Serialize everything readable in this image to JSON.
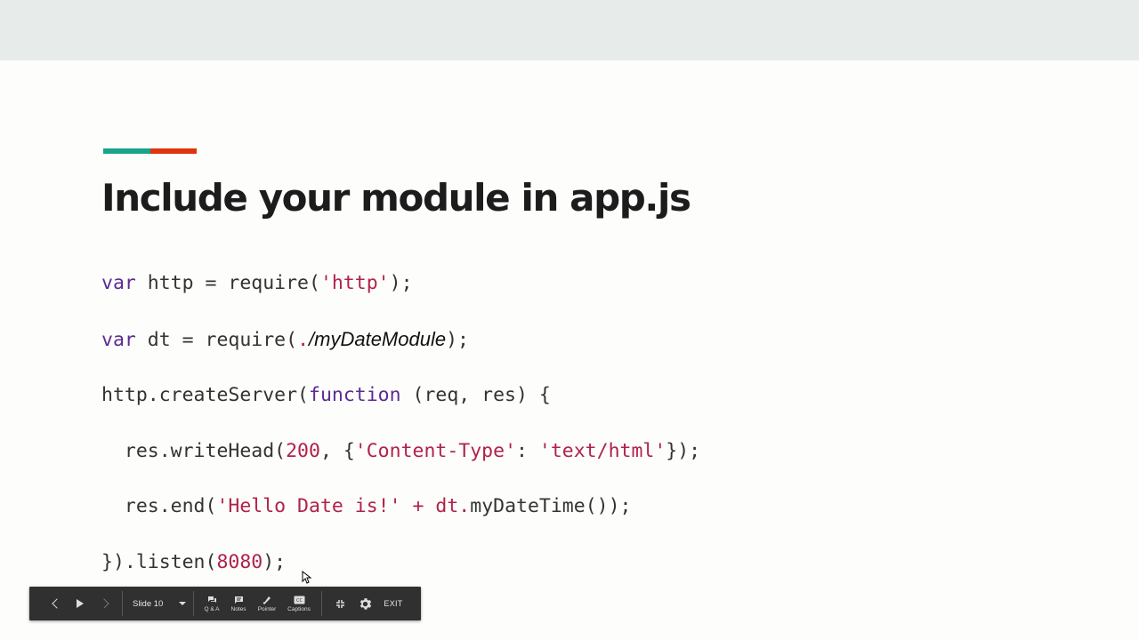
{
  "slide": {
    "title": "Include your module in app.js",
    "colors": {
      "accent_green": "#1aa389",
      "accent_red": "#e0340e",
      "keyword": "#5b2b94",
      "string": "#b0224a"
    },
    "code": {
      "l1_kw": "var",
      "l1_a": " http = require(",
      "l1_str": "'http'",
      "l1_b": ");",
      "l2_kw": "var",
      "l2_a": " dt = require(",
      "l2_dot": ".",
      "l2_it": "/myDateModule",
      "l2_b": ");",
      "l3_a": "http.createServer(",
      "l3_kw": "function",
      "l3_b": " (req, res) {",
      "l4_a": "  res.writeHead(",
      "l4_num": "200",
      "l4_b": ", {",
      "l4_str1": "'Content-Type'",
      "l4_c": ": ",
      "l4_str2": "'text/html'",
      "l4_d": "});",
      "l5_a": "  res.end(",
      "l5_str": "'Hello Date is!'",
      "l5_plus": " + ",
      "l5_dt": "dt.",
      "l5_b": "myDateTime());",
      "l6_a": "}).listen(",
      "l6_num": "8080",
      "l6_b": ");"
    }
  },
  "toolbar": {
    "slide_label": "Slide 10",
    "qa_label": "Q & A",
    "notes_label": "Notes",
    "pointer_label": "Pointer",
    "captions_label": "Captions",
    "exit_label": "EXIT",
    "icons": [
      "chevron-left-icon",
      "play-icon",
      "chevron-right-icon",
      "caret-down-icon",
      "qa-icon",
      "notes-icon",
      "pointer-icon",
      "captions-icon",
      "exit-fullscreen-icon",
      "gear-icon"
    ]
  }
}
